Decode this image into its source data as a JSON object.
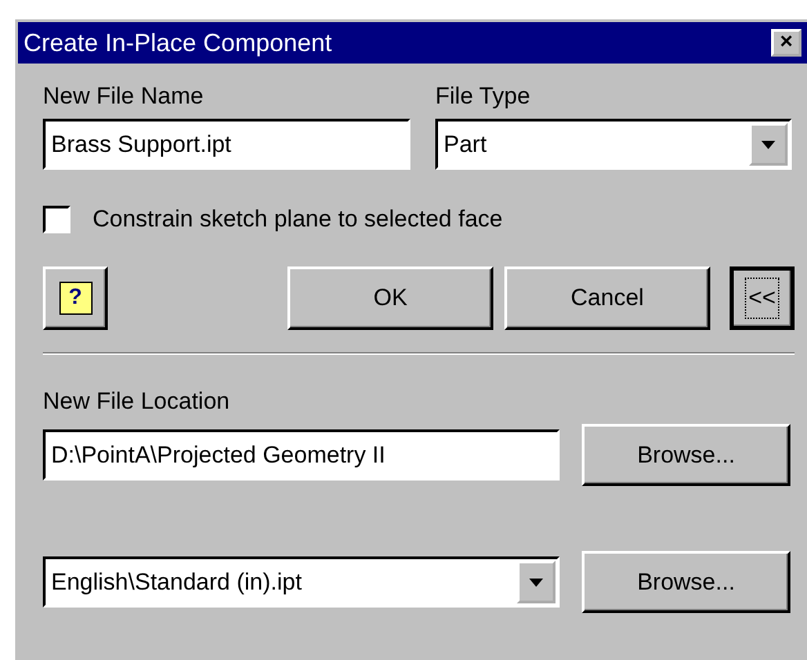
{
  "window": {
    "title": "Create In-Place Component",
    "close": "×"
  },
  "file_name": {
    "label": "New File Name",
    "value": "Brass Support.ipt"
  },
  "file_type": {
    "label": "File Type",
    "value": "Part"
  },
  "constrain": {
    "label": "Constrain sketch plane to selected face",
    "checked": false
  },
  "help_button": {
    "glyph": "?"
  },
  "buttons": [
    {
      "label": "OK",
      "kind": "plain"
    },
    {
      "label": "Cancel",
      "kind": "plain"
    },
    {
      "label": "<<",
      "kind": "focused"
    }
  ],
  "location": {
    "label": "New File Location",
    "value": "D:\\PointA\\Projected Geometry II",
    "browse": "Browse..."
  },
  "template": {
    "value": "English\\Standard (in).ipt",
    "browse": "Browse..."
  }
}
